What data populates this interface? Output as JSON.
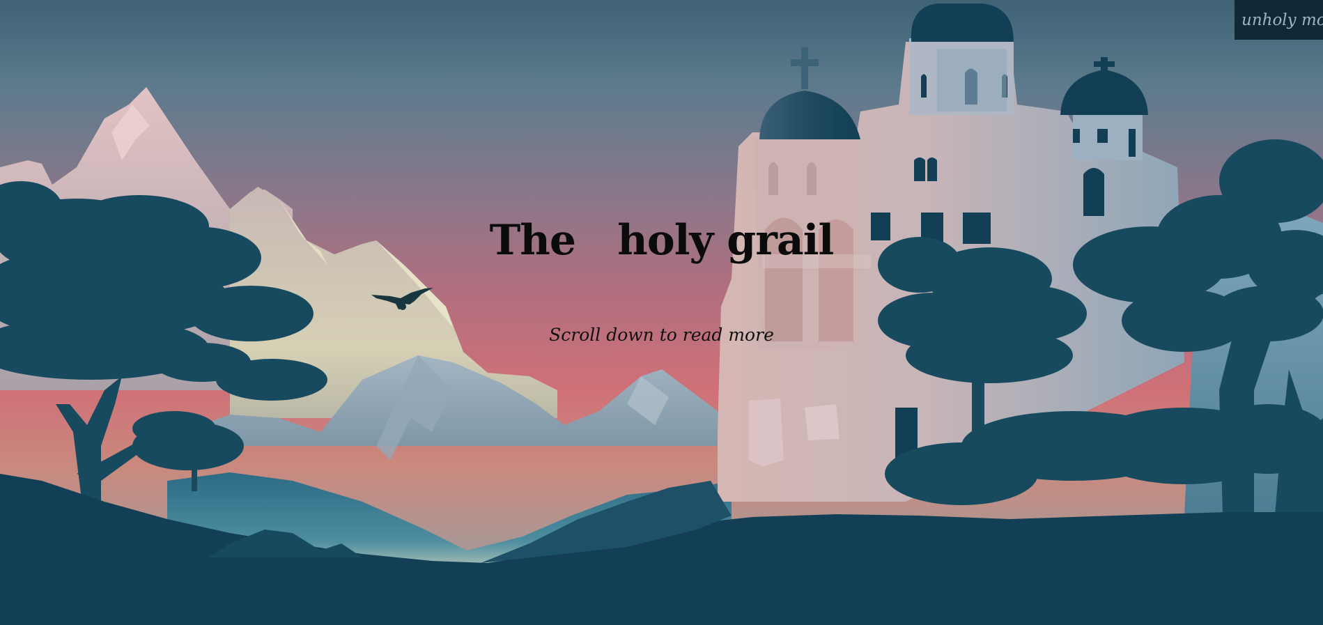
{
  "hero": {
    "title_part1": "The",
    "title_part2": "holy grail",
    "subtitle": "Scroll down to read more"
  },
  "mode_toggle": {
    "label": "unholy mode"
  },
  "colors": {
    "sky_top": "#3f6275",
    "sky_mid": "#86788a",
    "sky_glow": "#c9737c",
    "ground": "#123f55",
    "foliage": "#184a5f",
    "church": "#c9b3b3",
    "toggle_bg": "#0f2a36"
  },
  "icons": {
    "bird": "bird-silhouette-icon"
  }
}
